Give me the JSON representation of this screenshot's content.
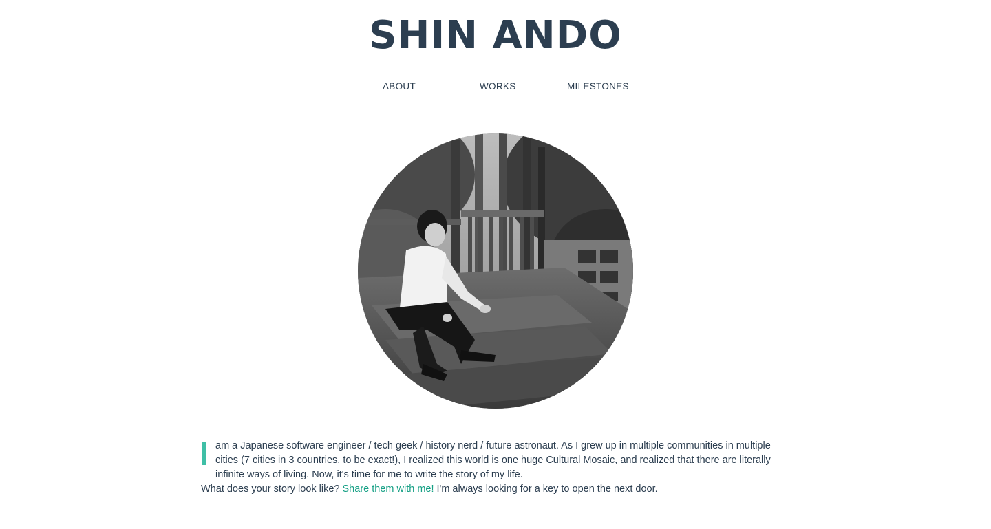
{
  "header": {
    "title": "SHIN ANDO"
  },
  "nav": {
    "items": [
      {
        "label": "ABOUT"
      },
      {
        "label": "WORKS"
      },
      {
        "label": "MILESTONES"
      }
    ]
  },
  "portrait": {
    "icon": "profile-photo",
    "style": "black-and-white circular photo"
  },
  "bio": {
    "dropcap_letter": "I",
    "paragraph_first": "am a Japanese software engineer / tech geek / history nerd / future astronaut. As I grew up in multiple communities in multiple cities (7 cities in 3 countries, to be exact!), I realized this world is one huge Cultural Mosaic, and realized that there are literally infinite ways of living. Now, it's time for me to write the story of my life.",
    "question": "What does your story look like?",
    "link_text": "Share them with me!",
    "closing": "I'm always looking for a key to open the next door."
  },
  "colors": {
    "text": "#2c3e50",
    "accent": "#3fbfa6",
    "link": "#16a085",
    "background": "#ffffff"
  }
}
